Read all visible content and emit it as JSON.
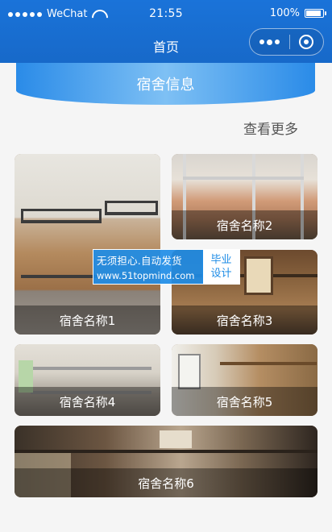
{
  "status_bar": {
    "carrier": "WeChat",
    "time": "21:55",
    "battery": "100%"
  },
  "nav": {
    "title": "首页"
  },
  "banner": {
    "title": "宿舍信息"
  },
  "more_link": "查看更多",
  "dorms": [
    {
      "name": "宿舍名称1"
    },
    {
      "name": "宿舍名称2"
    },
    {
      "name": "宿舍名称3"
    },
    {
      "name": "宿舍名称4"
    },
    {
      "name": "宿舍名称5"
    },
    {
      "name": "宿舍名称6"
    }
  ],
  "watermark": {
    "line1": "无须担心.自动发货",
    "line2": "www.51topmind.com",
    "right_line1": "毕业",
    "right_line2": "设计"
  },
  "colors": {
    "nav_blue": "#1a73d9",
    "banner_blue": "#2a8be8"
  }
}
